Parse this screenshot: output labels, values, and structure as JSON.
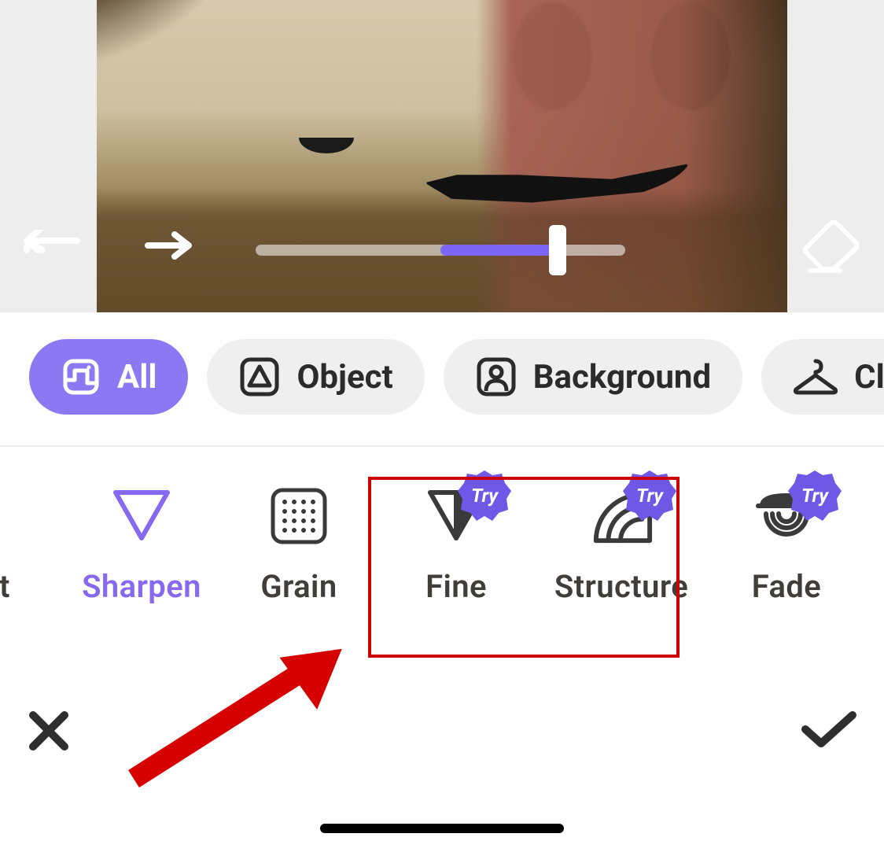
{
  "slider": {
    "min": 0,
    "max": 100,
    "value": 80
  },
  "categories": {
    "all": {
      "label": "All",
      "icon": "crop-icon",
      "active": true
    },
    "object": {
      "label": "Object",
      "icon": "object-icon",
      "active": false
    },
    "background": {
      "label": "Background",
      "icon": "person-icon",
      "active": false
    },
    "clothes": {
      "label": "Cl",
      "icon": "hanger-icon",
      "active": false
    }
  },
  "tools": {
    "partial_left": {
      "label": "st"
    },
    "sharpen": {
      "label": "Sharpen",
      "active": true,
      "try": false
    },
    "grain": {
      "label": "Grain",
      "active": false,
      "try": false
    },
    "fine": {
      "label": "Fine",
      "active": false,
      "try": true
    },
    "structure": {
      "label": "Structure",
      "active": false,
      "try": true
    },
    "fade": {
      "label": "Fade",
      "active": false,
      "try": true
    }
  },
  "badge": {
    "try_label": "Try"
  },
  "colors": {
    "accent": "#8b78f2",
    "accent_light": "#8768f0",
    "annotation_red": "#cf0000",
    "pill_bg": "#efefef",
    "text": "#403d3a"
  },
  "annotation": {
    "highlight_targets": [
      "fine",
      "structure"
    ],
    "arrow_points_to": "highlight-box"
  }
}
